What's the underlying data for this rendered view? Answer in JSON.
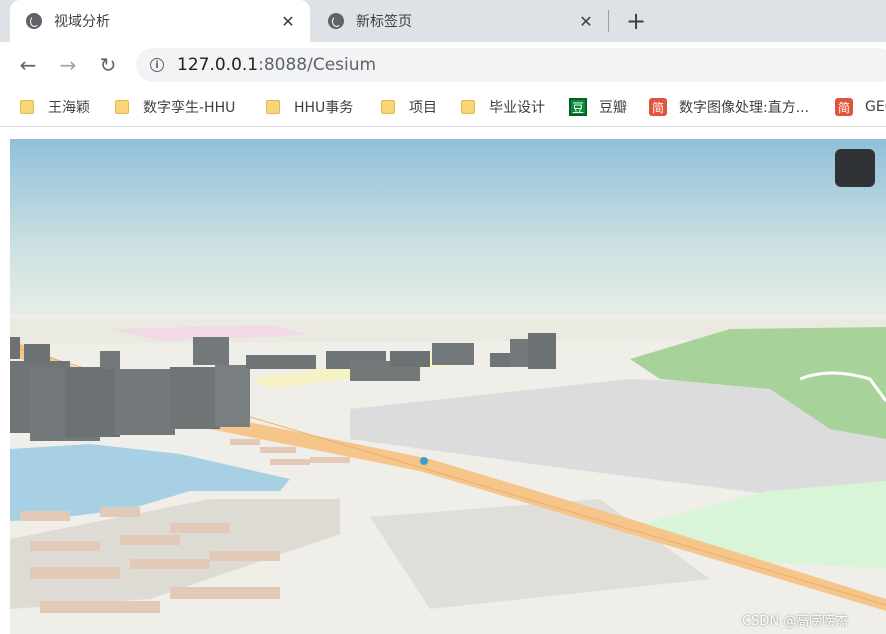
{
  "tabs": [
    {
      "title": "视域分析",
      "close": "✕",
      "active": true
    },
    {
      "title": "新标签页",
      "close": "✕",
      "active": false
    }
  ],
  "new_tab": "+",
  "nav": {
    "back": "←",
    "forward": "→",
    "reload": "↻"
  },
  "address": {
    "host": "127.0.0.1",
    "rest": ":8088/Cesium",
    "info_glyph": "i"
  },
  "bookmarks": [
    {
      "icon": "folder-icon",
      "label": "王海颖"
    },
    {
      "icon": "folder-icon",
      "label": "数字孪生-HHU"
    },
    {
      "icon": "folder-icon",
      "label": "HHU事务"
    },
    {
      "icon": "folder-icon",
      "label": "项目"
    },
    {
      "icon": "folder-icon",
      "label": "毕业设计"
    },
    {
      "icon": "douban-icon",
      "glyph": "豆",
      "label": "豆瓣"
    },
    {
      "icon": "jianshu-icon",
      "glyph": "简",
      "label": "数字图像处理:直方..."
    },
    {
      "icon": "jianshu-icon",
      "glyph": "简",
      "label": "GEO"
    }
  ],
  "watermark": "CSDN @高唠唠杰",
  "colors": {
    "sky_top": "#8fc0db",
    "sky_horizon": "#e9efe8",
    "ground": "#f0eee9",
    "road": "#f5c58a",
    "water": "#a8d0e4",
    "park": "#a7d39a",
    "building": "#73797b",
    "home_button": "#303336"
  }
}
